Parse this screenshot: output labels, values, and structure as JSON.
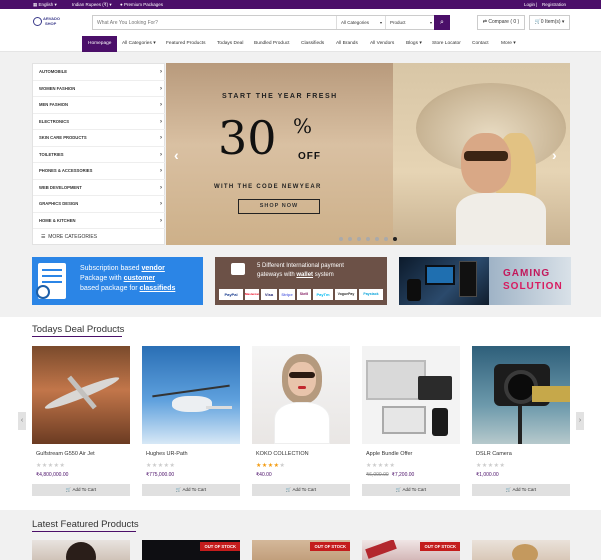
{
  "topbar": {
    "language": "English",
    "currency": "Indian Rupees (₹)",
    "premium": "Premium Packages",
    "login": "Login",
    "registration": "Registration"
  },
  "header": {
    "logo_line1": "ARVADO",
    "logo_line2": "SHOP",
    "search_placeholder": "What Are You Looking For?",
    "category_select": "All Categories",
    "type_select": "Product",
    "compare": "Compare ( 0 )",
    "cart": "0 Item(s)"
  },
  "nav": {
    "items": [
      "Homepage",
      "All Categories",
      "Featured Products",
      "Todays Deal",
      "Bundled Product",
      "Classifieds",
      "All Brands",
      "All Vendors",
      "Blogs",
      "Store Locator",
      "Contact",
      "More"
    ]
  },
  "sidebar": {
    "categories": [
      "AUTOMOBILE",
      "WOMEN FASHION",
      "MEN FASHION",
      "ELECTRONICS",
      "SKIN CARE PRODUCTS",
      "TOILETRIES",
      "PHONES & ACCESSORIES",
      "WEB DEVELOPMENT",
      "GRAPHICS DESIGN",
      "HOME & KITCHEN"
    ],
    "more": "MORE CATEGORIES"
  },
  "slider": {
    "line1": "START THE YEAR FRESH",
    "big": "30",
    "pct": "%",
    "off": "OFF",
    "code_text": "WITH THE CODE",
    "code": "NEWYEAR",
    "button": "SHOP NOW",
    "dot_count": 7,
    "active_dot": 6
  },
  "banners": {
    "b1": {
      "l1a": "Subscription based ",
      "l1b": "vendor",
      "l2a": "Package with ",
      "l2b": "customer",
      "l3a": "based package for ",
      "l3b": "classifieds"
    },
    "b2": {
      "l1": "5 Different International payment",
      "l2a": "gateways with ",
      "l2b": "wallet",
      "l2c": " system",
      "pay": [
        "PayPal",
        "Mastercard",
        "Visa",
        "Stripe",
        "Skrill",
        "PayTm",
        "VoguePay",
        "Paystack"
      ]
    },
    "b3": {
      "l1": "GAMING",
      "l2": "SOLUTION"
    }
  },
  "deals": {
    "title": "Todays Deal Products",
    "products": [
      {
        "name": "Gulfstream G550 Air Jet",
        "price": "₹4,800,000.00",
        "old": "",
        "rating": 0
      },
      {
        "name": "Hughes UR-Path",
        "price": "₹775,000.00",
        "old": "",
        "rating": 0
      },
      {
        "name": "KOKO COLLECTION",
        "price": "₹40.00",
        "old": "",
        "rating": 4
      },
      {
        "name": "Apple Bundle Offer",
        "price": "₹7,200.00",
        "old": "₹6,000.00",
        "rating": 0
      },
      {
        "name": "DSLR Camera",
        "price": "₹1,000.00",
        "old": "",
        "rating": 0
      }
    ],
    "cart_label": "Add To Cart"
  },
  "featured": {
    "title": "Latest Featured Products",
    "oos_label": "OUT OF STOCK"
  }
}
